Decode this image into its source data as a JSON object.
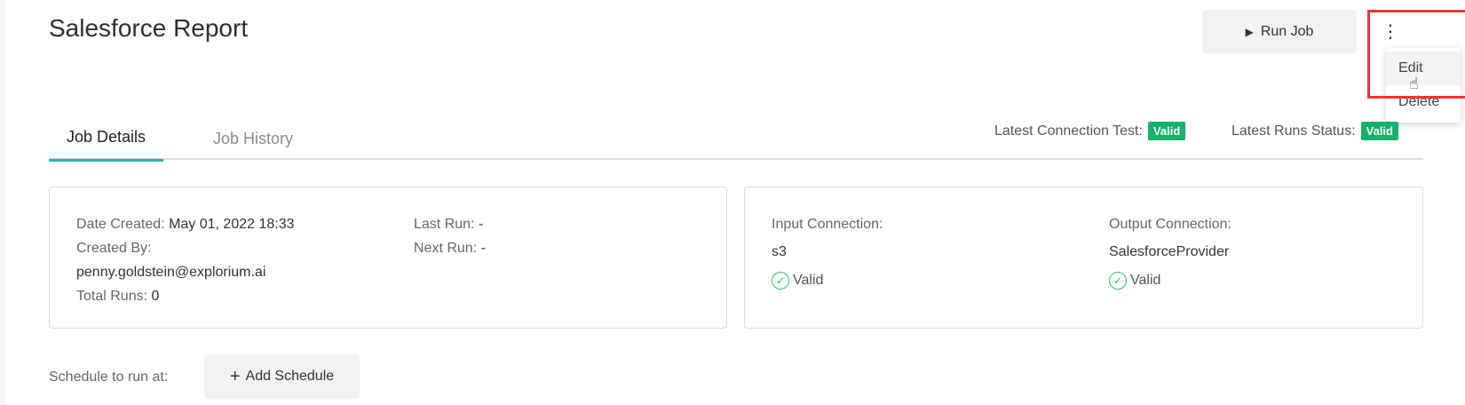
{
  "page": {
    "title": "Salesforce Report"
  },
  "toolbar": {
    "run_job_label": "Run Job",
    "play_icon": "▶",
    "more_icon": "⋮"
  },
  "menu": {
    "items": [
      {
        "label": "Edit"
      },
      {
        "label": "Delete"
      }
    ]
  },
  "tabs": [
    {
      "label": "Job Details",
      "active": true
    },
    {
      "label": "Job History",
      "active": false
    }
  ],
  "status": {
    "connection_test_label": "Latest Connection Test:",
    "connection_test_value": "Valid",
    "runs_status_label": "Latest Runs Status:",
    "runs_status_value": "Valid",
    "badge_color": "#17b26a"
  },
  "job_details": {
    "date_created_label": "Date Created:",
    "date_created_value": "May 01, 2022 18:33",
    "created_by_label": "Created By:",
    "created_by_value": "penny.goldstein@explorium.ai",
    "total_runs_label": "Total Runs:",
    "total_runs_value": "0",
    "last_run_label": "Last Run:",
    "last_run_value": "-",
    "next_run_label": "Next Run:",
    "next_run_value": "-"
  },
  "connections": {
    "input_label": "Input Connection:",
    "input_value": "s3",
    "input_status": "Valid",
    "output_label": "Output Connection:",
    "output_value": "SalesforceProvider",
    "output_status": "Valid"
  },
  "schedule": {
    "label": "Schedule to run at:",
    "add_label": "Add Schedule",
    "plus_icon": "+"
  },
  "colors": {
    "accent": "#26b8a0",
    "valid": "#2fbf71",
    "highlight": "#e53935"
  }
}
